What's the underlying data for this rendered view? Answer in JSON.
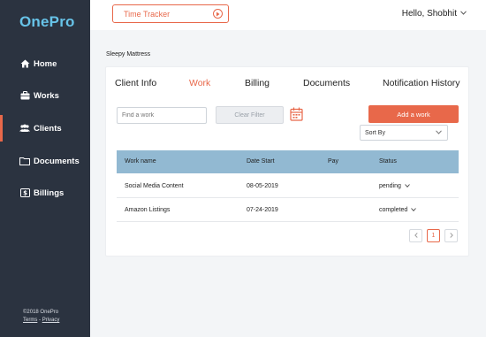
{
  "sidebar": {
    "brand": "OnePro",
    "items": [
      {
        "label": "Home",
        "icon": "home-icon"
      },
      {
        "label": "Works",
        "icon": "briefcase-icon"
      },
      {
        "label": "Clients",
        "icon": "users-icon",
        "active": true
      },
      {
        "label": "Documents",
        "icon": "folder-icon"
      },
      {
        "label": "Billings",
        "icon": "dollar-icon"
      }
    ],
    "footer": {
      "copyright": "©2018 OnePro",
      "terms": "Terms",
      "separator": "-",
      "privacy": "Privacy"
    }
  },
  "header": {
    "tracker_label": "Time Tracker",
    "greeting": "Hello, Shobhit"
  },
  "main": {
    "client_name": "Sleepy Mattress",
    "tabs": [
      "Client Info",
      "Work",
      "Billing",
      "Documents",
      "Notification History"
    ],
    "active_tab": "Work",
    "toolbar": {
      "find_placeholder": "Find a work",
      "clear_label": "Clear Filter",
      "add_label": "Add a work",
      "sort_label": "Sort By"
    },
    "table": {
      "columns": [
        "Work name",
        "Date Start",
        "Pay",
        "Status"
      ],
      "rows": [
        {
          "name": "Social Media Content",
          "date": "08-05-2019",
          "pay": "",
          "status": "pending"
        },
        {
          "name": "Amazon Listings",
          "date": "07-24-2019",
          "pay": "",
          "status": "completed"
        }
      ]
    },
    "pagination": {
      "current_page": "1"
    }
  },
  "colors": {
    "sidebar_bg": "#2b3340",
    "brand": "#67c3e8",
    "accent": "#e8684a",
    "table_header": "#92b9d2"
  }
}
